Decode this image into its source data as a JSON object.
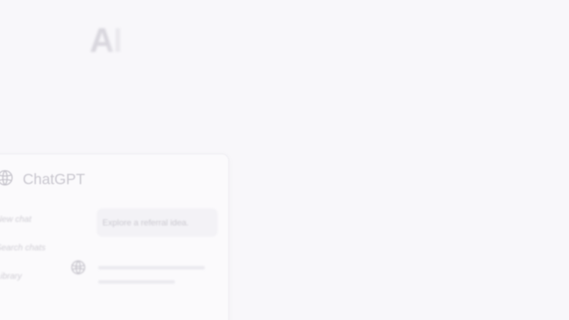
{
  "hero": {
    "title": "AI"
  },
  "app": {
    "name": "ChatGPT"
  },
  "sidebar": {
    "items": [
      {
        "label": "New chat"
      },
      {
        "label": "Search chats"
      },
      {
        "label": "Library"
      }
    ]
  },
  "main": {
    "suggestion": "Explore a referral idea."
  },
  "icons": {
    "brand": "openai-logo-icon",
    "assistant": "openai-logo-icon"
  },
  "colors": {
    "background": "#f8f7fa",
    "card": "#fbfafc",
    "text_faint": "#c9c7cf"
  }
}
